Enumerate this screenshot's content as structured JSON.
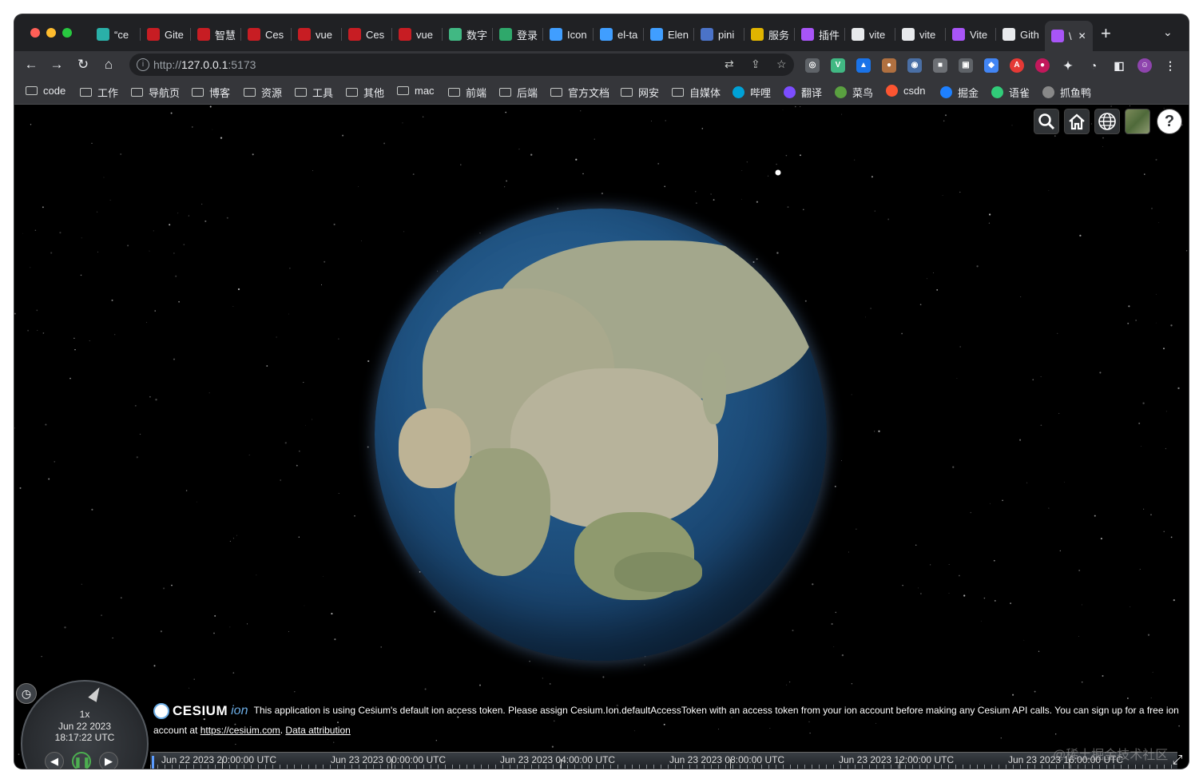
{
  "browser": {
    "tabs": [
      {
        "label": "“ce",
        "icon": "vite-icon",
        "color": "#2ab0a8"
      },
      {
        "label": "Gite",
        "icon": "gitee-icon",
        "color": "#c71d23"
      },
      {
        "label": "智慧",
        "icon": "gitee-icon",
        "color": "#c71d23"
      },
      {
        "label": "Ces",
        "icon": "gitee-icon",
        "color": "#c71d23"
      },
      {
        "label": "vue",
        "icon": "gitee-icon",
        "color": "#c71d23"
      },
      {
        "label": "Ces",
        "icon": "gitee-icon",
        "color": "#c71d23"
      },
      {
        "label": "vue",
        "icon": "gitee-icon",
        "color": "#c71d23"
      },
      {
        "label": "数字",
        "icon": "vue-icon",
        "color": "#41b883"
      },
      {
        "label": "登录",
        "icon": "shield-icon",
        "color": "#2fa86b"
      },
      {
        "label": "Icon",
        "icon": "element-icon",
        "color": "#409eff"
      },
      {
        "label": "el-ta",
        "icon": "element-icon",
        "color": "#409eff"
      },
      {
        "label": "Elen",
        "icon": "element-icon",
        "color": "#409eff"
      },
      {
        "label": "pini",
        "icon": "pinia-icon",
        "color": "#4b73c8"
      },
      {
        "label": "服务",
        "icon": "pineapple-icon",
        "color": "#e0b400"
      },
      {
        "label": "插件",
        "icon": "vite-icon",
        "color": "#a855f7"
      },
      {
        "label": "vite",
        "icon": "github-icon",
        "color": "#e8eaed"
      },
      {
        "label": "vite",
        "icon": "github-icon",
        "color": "#e8eaed"
      },
      {
        "label": "Vite",
        "icon": "vite-icon",
        "color": "#a855f7"
      },
      {
        "label": "Gith",
        "icon": "github-icon",
        "color": "#e8eaed"
      },
      {
        "label": "\\",
        "icon": "vite-icon",
        "color": "#a855f7",
        "active": true
      }
    ],
    "new_tab": "+",
    "tab_menu": "⌄",
    "url_prefix": "http://",
    "url_host": "127.0.0.1",
    "url_port": ":5173",
    "bookmarks": [
      {
        "label": "code",
        "type": "folder"
      },
      {
        "label": "工作",
        "type": "folder"
      },
      {
        "label": "导航页",
        "type": "folder"
      },
      {
        "label": "博客",
        "type": "folder"
      },
      {
        "label": "资源",
        "type": "folder"
      },
      {
        "label": "工具",
        "type": "folder"
      },
      {
        "label": "其他",
        "type": "folder"
      },
      {
        "label": "mac",
        "type": "folder"
      },
      {
        "label": "前端",
        "type": "folder"
      },
      {
        "label": "后端",
        "type": "folder"
      },
      {
        "label": "官方文档",
        "type": "folder"
      },
      {
        "label": "网安",
        "type": "folder"
      },
      {
        "label": "自媒体",
        "type": "folder"
      },
      {
        "label": "哔哩",
        "type": "bilibili-icon",
        "color": "#00a1d6"
      },
      {
        "label": "翻译",
        "type": "translate-icon",
        "color": "#7c4dff"
      },
      {
        "label": "菜鸟",
        "type": "runoob-icon",
        "color": "#5aa040"
      },
      {
        "label": "csdn",
        "type": "csdn-icon",
        "color": "#fc5531"
      },
      {
        "label": "掘金",
        "type": "juejin-icon",
        "color": "#1e80ff"
      },
      {
        "label": "语雀",
        "type": "yuque-icon",
        "color": "#31cc79"
      },
      {
        "label": "抓鱼鸭",
        "type": "duck-icon",
        "color": "#888888"
      }
    ]
  },
  "cesium": {
    "toolbar": [
      "search-icon",
      "home-icon",
      "globe-icon",
      "layers-icon",
      "help-icon"
    ],
    "help_label": "?",
    "animation": {
      "speed": "1x",
      "date": "Jun 22 2023",
      "time": "18:17:22 UTC"
    },
    "credits": {
      "logo_text": "CESIUM",
      "logo_ion": "ion",
      "message": "This application is using Cesium's default ion access token. Please assign Cesium.Ion.defaultAccessToken with an access token from your ion account before making any Cesium API calls. You can sign up for a free ion account at",
      "link": "https://cesium.com",
      "attribution": "Data attribution"
    },
    "timeline": [
      "Jun 22 2023 20:00:00 UTC",
      "Jun 23 2023 00:00:00 UTC",
      "Jun 23 2023 04:00:00 UTC",
      "Jun 23 2023 08:00:00 UTC",
      "Jun 23 2023 12:00:00 UTC",
      "Jun 23 2023 16:00:00 UTC"
    ]
  },
  "watermark": "@稀土掘金技术社区"
}
